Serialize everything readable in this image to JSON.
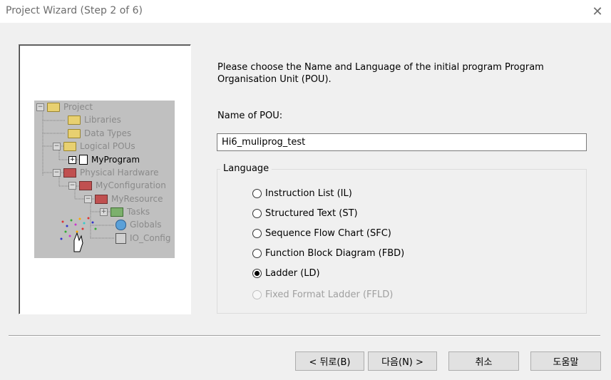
{
  "window": {
    "title": "Project Wizard (Step 2 of 6)",
    "close_icon": "close-icon"
  },
  "tree": {
    "items": [
      {
        "label": "Project",
        "icon": "folder-open-icon"
      },
      {
        "label": "Libraries",
        "icon": "folder-icon"
      },
      {
        "label": "Data Types",
        "icon": "folder-icon"
      },
      {
        "label": "Logical POUs",
        "icon": "folder-open-icon"
      },
      {
        "label": "MyProgram",
        "icon": "program-icon"
      },
      {
        "label": "Physical Hardware",
        "icon": "hardware-icon"
      },
      {
        "label": "MyConfiguration",
        "icon": "configuration-icon"
      },
      {
        "label": "MyResource",
        "icon": "resource-icon"
      },
      {
        "label": "Tasks",
        "icon": "tasks-icon"
      },
      {
        "label": "Globals",
        "icon": "globals-icon"
      },
      {
        "label": "IO_Config",
        "icon": "io-config-icon"
      }
    ]
  },
  "main": {
    "instruction": "Please choose the Name and Language of the initial program Program Organisation Unit (POU).",
    "pou_label": "Name of POU:",
    "pou_value": "Hi6_muliprog_test",
    "language_legend": "Language",
    "languages": [
      {
        "label": "Instruction List (IL)",
        "checked": false,
        "enabled": true
      },
      {
        "label": "Structured Text (ST)",
        "checked": false,
        "enabled": true
      },
      {
        "label": "Sequence Flow Chart (SFC)",
        "checked": false,
        "enabled": true
      },
      {
        "label": "Function Block Diagram (FBD)",
        "checked": false,
        "enabled": true
      },
      {
        "label": "Ladder (LD)",
        "checked": true,
        "enabled": true
      },
      {
        "label": "Fixed Format Ladder (FFLD)",
        "checked": false,
        "enabled": false
      }
    ]
  },
  "buttons": {
    "back": "< 뒤로(B)",
    "next": "다음(N) >",
    "cancel": "취소",
    "help": "도움말"
  }
}
